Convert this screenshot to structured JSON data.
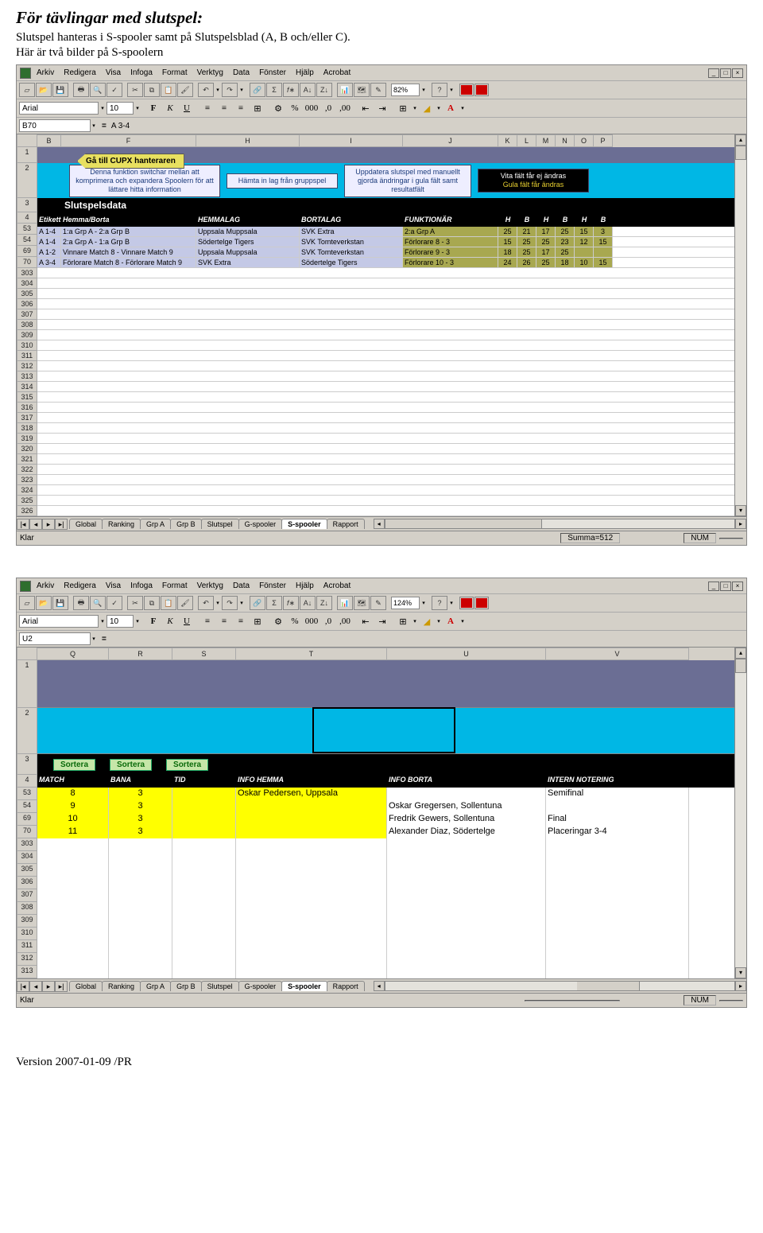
{
  "doc": {
    "title": "För tävlingar med slutspel:",
    "subtitle": "Slutspel hanteras i S-spooler samt på Slutspelsblad (A, B och/eller C).",
    "note": "Här är två bilder på S-spoolern",
    "footer": "Version 2007-01-09 /PR"
  },
  "menus": [
    "Arkiv",
    "Redigera",
    "Visa",
    "Infoga",
    "Format",
    "Verktyg",
    "Data",
    "Fönster",
    "Hjälp",
    "Acrobat"
  ],
  "shot1": {
    "zoom": "82%",
    "font": "Arial",
    "fontsize": "10",
    "namebox": "B70",
    "formula": "A 3-4",
    "cols": [
      "B",
      "F",
      "H",
      "I",
      "J",
      "H",
      "B",
      "H",
      "B",
      "H",
      "B"
    ],
    "nav_arrow": "Gå till CUPX hanteraren",
    "panels": [
      "Denna funktion switchar mellan att komprimera och expandera Spoolern för att lättare hitta information",
      "Hämta in lag från gruppspel",
      "Uppdatera slutspel med manuellt gjorda ändringar i gula fält samt resultatfält",
      "Vita fält får ej ändras\nGula fält får ändras"
    ],
    "section_title": "Slutspelsdata",
    "headers": [
      "Etikett",
      "Hemma/Borta",
      "HEMMALAG",
      "BORTALAG",
      "FUNKTIONÄR",
      "H",
      "B",
      "H",
      "B",
      "H",
      "B"
    ],
    "rownums_top": [
      "1",
      "2",
      "3",
      "4",
      "53",
      "54",
      "69",
      "70"
    ],
    "rownums_rest": [
      "303",
      "304",
      "305",
      "306",
      "307",
      "308",
      "309",
      "310",
      "311",
      "312",
      "313",
      "314",
      "315",
      "316",
      "317",
      "318",
      "319",
      "320",
      "321",
      "322",
      "323",
      "324",
      "325",
      "326"
    ],
    "rows": [
      {
        "et": "A 1-4",
        "hb": "1:a Grp A - 2:a Grp B",
        "hl": "Uppsala Muppsala",
        "bl": "SVK Extra",
        "fn": "2:a Grp A",
        "s": [
          "25",
          "21",
          "17",
          "25",
          "15",
          "3"
        ]
      },
      {
        "et": "A 1-4",
        "hb": "2:a Grp A - 1:a Grp B",
        "hl": "Södertelge Tigers",
        "bl": "SVK Tomteverkstan",
        "fn": "Förlorare 8 - 3",
        "s": [
          "15",
          "25",
          "25",
          "23",
          "12",
          "15"
        ]
      },
      {
        "et": "A 1-2",
        "hb": "Vinnare Match 8 - Vinnare Match 9",
        "hl": "Uppsala Muppsala",
        "bl": "SVK Tomteverkstan",
        "fn": "Förlorare 9 - 3",
        "s": [
          "18",
          "25",
          "17",
          "25",
          "",
          ""
        ]
      },
      {
        "et": "A 3-4",
        "hb": "Förlorare Match 8 - Förlorare Match 9",
        "hl": "SVK Extra",
        "bl": "Södertelge Tigers",
        "fn": "Förlorare 10 - 3",
        "s": [
          "24",
          "26",
          "25",
          "18",
          "10",
          "15"
        ]
      }
    ],
    "tabs": [
      "Global",
      "Ranking",
      "Grp A",
      "Grp B",
      "Slutspel",
      "G-spooler",
      "S-spooler",
      "Rapport"
    ],
    "active_tab": "S-spooler",
    "status_left": "Klar",
    "status_sum": "Summa=512",
    "status_num": "NUM"
  },
  "shot2": {
    "zoom": "124%",
    "font": "Arial",
    "fontsize": "10",
    "namebox": "U2",
    "formula": "",
    "cols": [
      "Q",
      "R",
      "S",
      "T",
      "U",
      "V"
    ],
    "sortera": "Sortera",
    "headers": [
      "MATCH",
      "BANA",
      "TID",
      "INFO HEMMA",
      "INFO BORTA",
      "INTERN NOTERING"
    ],
    "rownums_top": [
      "",
      "1",
      "2",
      "3",
      "4",
      "53",
      "54",
      "69",
      "70"
    ],
    "rownums_rest": [
      "303",
      "304",
      "305",
      "306",
      "307",
      "308",
      "309",
      "310",
      "311",
      "312",
      "313"
    ],
    "rows": [
      {
        "m": "8",
        "b": "3",
        "t": "",
        "ih": "Oskar Pedersen, Uppsala",
        "ib": "",
        "n": "Semifinal"
      },
      {
        "m": "9",
        "b": "3",
        "t": "",
        "ih": "",
        "ib": "Oskar Gregersen, Sollentuna",
        "n": ""
      },
      {
        "m": "10",
        "b": "3",
        "t": "",
        "ih": "",
        "ib": "Fredrik Gewers, Sollentuna",
        "n": "Final"
      },
      {
        "m": "11",
        "b": "3",
        "t": "",
        "ih": "",
        "ib": "Alexander Diaz, Södertelge",
        "n": "Placeringar 3-4"
      }
    ],
    "tabs": [
      "Global",
      "Ranking",
      "Grp A",
      "Grp B",
      "Slutspel",
      "G-spooler",
      "S-spooler",
      "Rapport"
    ],
    "active_tab": "S-spooler",
    "status_left": "Klar",
    "status_num": "NUM"
  }
}
